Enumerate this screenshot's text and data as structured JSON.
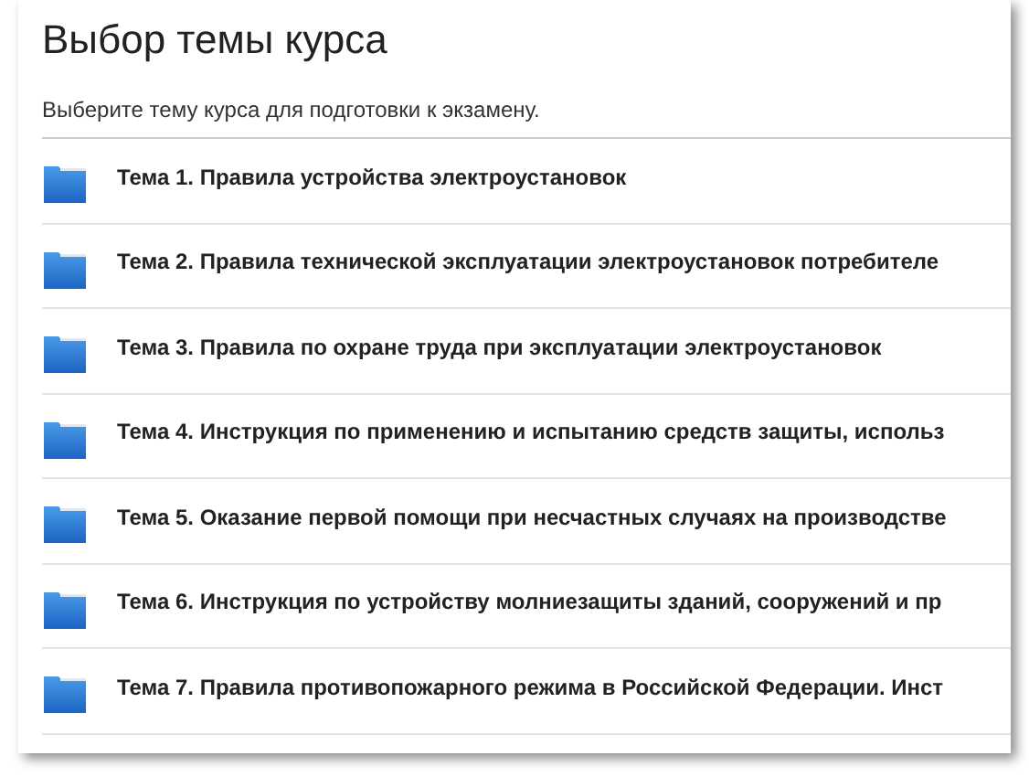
{
  "header": {
    "title": "Выбор темы курса",
    "subtitle": "Выберите тему курса для подготовки к экзамену."
  },
  "topics": [
    {
      "label": "Тема 1. Правила устройства электроустановок"
    },
    {
      "label": "Тема 2. Правила технической эксплуатации электроустановок потребителе"
    },
    {
      "label": "Тема 3. Правила по охране труда при эксплуатации электроустановок"
    },
    {
      "label": "Тема 4. Инструкция по применению и испытанию средств защиты, использ"
    },
    {
      "label": "Тема 5. Оказание первой помощи при несчастных случаях на производстве"
    },
    {
      "label": "Тема 6. Инструкция по устройству молниезащиты зданий, сооружений и пр"
    },
    {
      "label": "Тема 7. Правила противопожарного режима в Российской Федерации. Инст"
    }
  ]
}
